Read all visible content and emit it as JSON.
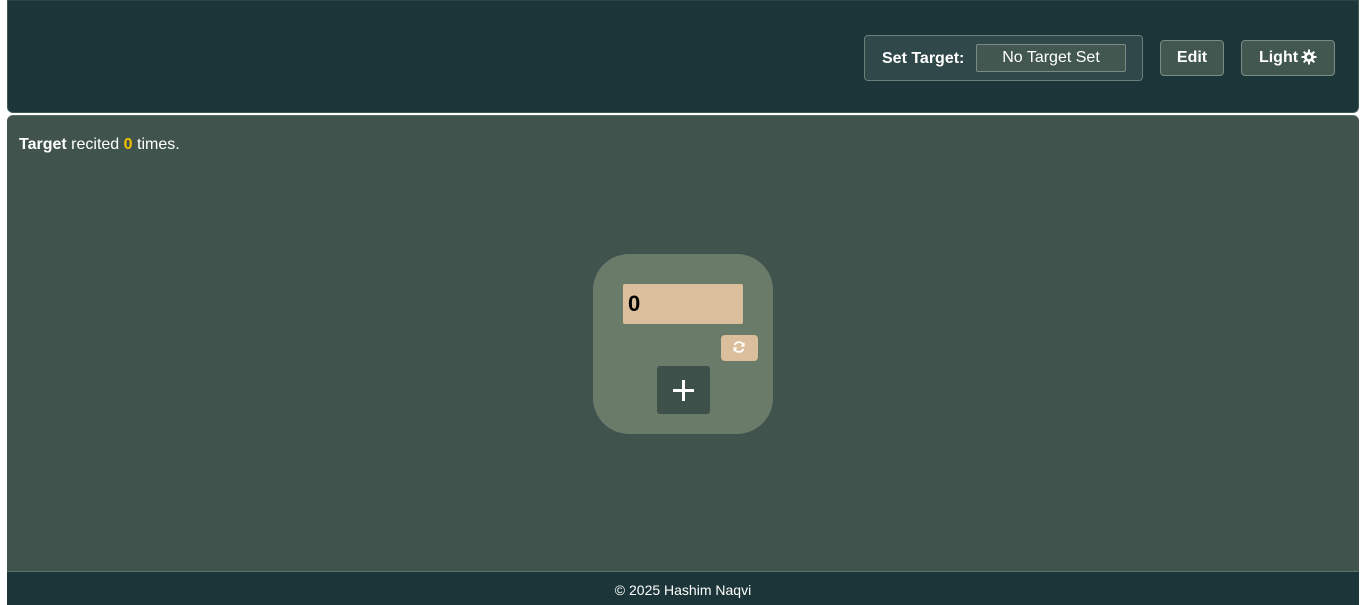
{
  "header": {
    "set_target_label": "Set Target:",
    "target_value": "No Target Set",
    "edit_label": "Edit",
    "theme_label": "Light",
    "theme_icon": "gear-icon"
  },
  "main": {
    "target_word": "Target",
    "recited_word": "recited",
    "recited_count": "0",
    "times_word": "times.",
    "counter_value": "0",
    "reset_icon": "refresh-icon",
    "increment_icon": "plus-icon"
  },
  "footer": {
    "copyright": "© 2025 Hashim Naqvi"
  },
  "colors": {
    "header_bg": "#1c3538",
    "main_bg": "#40534d",
    "card_bg": "#6a7c69",
    "display_bg": "#dbbf9d",
    "count_highlight": "#f0c000"
  }
}
